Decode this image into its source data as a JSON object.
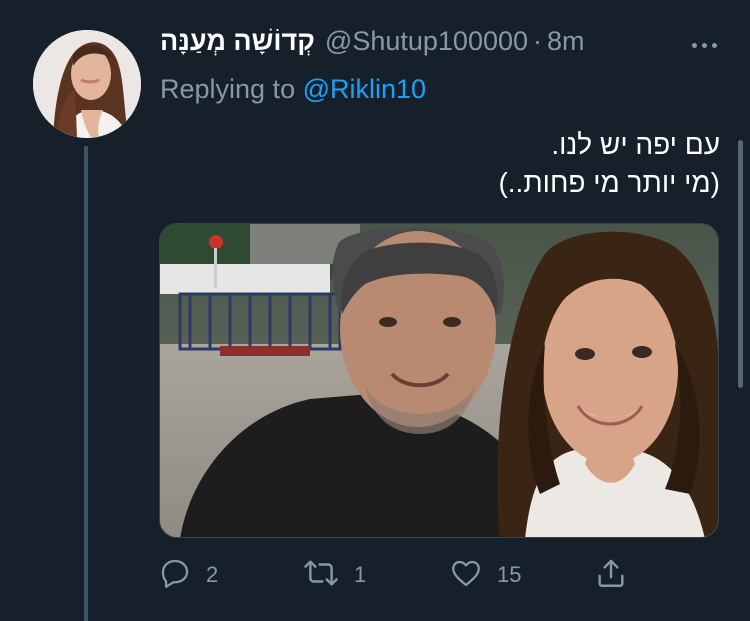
{
  "author": {
    "display_name": "קְדוֹשָׁה מְעַנָּה",
    "handle": "@Shutup100000",
    "separator": "·",
    "time": "8m"
  },
  "reply_context": {
    "prefix": "Replying to",
    "mention": "@Riklin10"
  },
  "tweet": {
    "line1": "עם יפה יש לנו.",
    "line2": "(מי יותר מי פחות..)"
  },
  "actions": {
    "reply": {
      "icon": "reply-icon",
      "count": "2"
    },
    "retweet": {
      "icon": "retweet-icon",
      "count": "1"
    },
    "like": {
      "icon": "heart-icon",
      "count": "15"
    },
    "share": {
      "icon": "share-icon"
    }
  },
  "colors": {
    "background": "#15202b",
    "secondary_text": "#8899a6",
    "link": "#1da1f2"
  }
}
